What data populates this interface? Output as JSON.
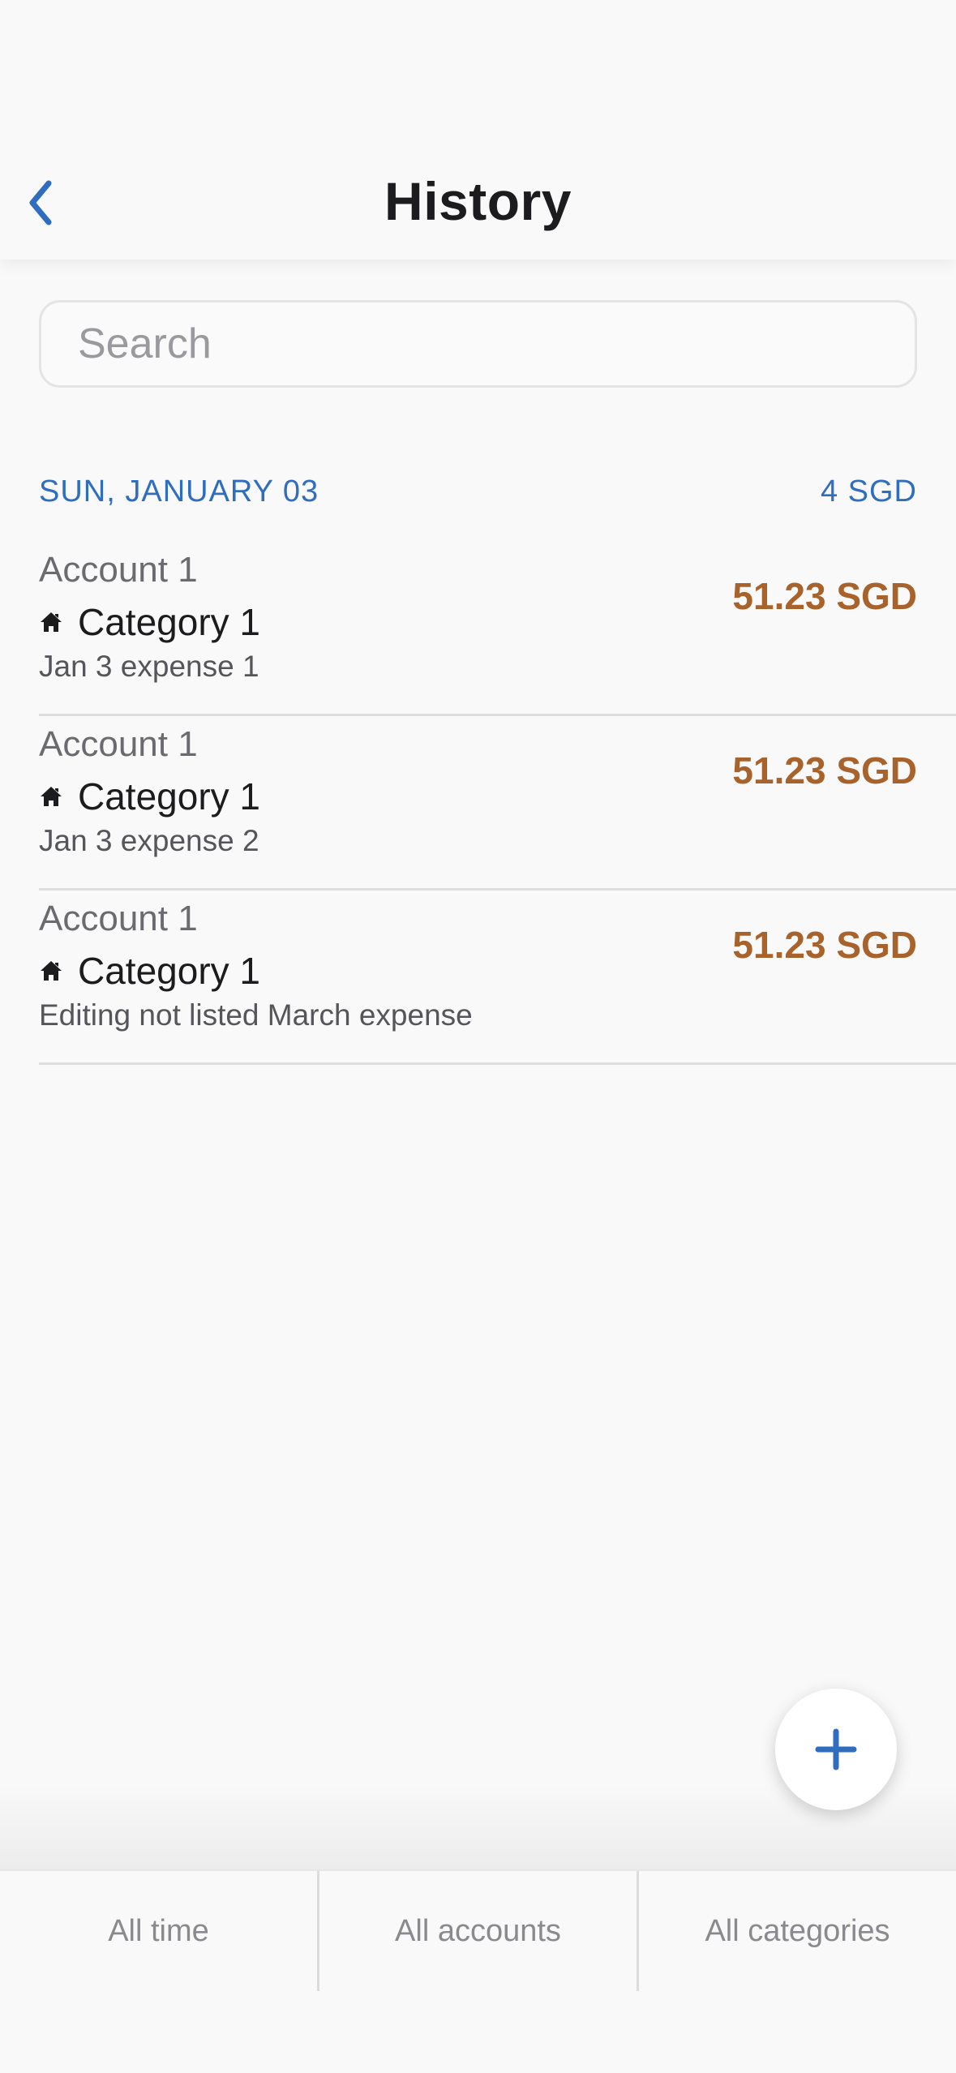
{
  "header": {
    "title": "History",
    "back_icon": "chevron-left-icon"
  },
  "search": {
    "placeholder": "Search",
    "value": ""
  },
  "section": {
    "date": "SUN, JANUARY 03",
    "total": "4 SGD"
  },
  "transactions": [
    {
      "account": "Account 1",
      "category": "Category 1",
      "category_icon": "home-icon",
      "note": "Jan 3 expense 1",
      "amount": "51.23 SGD"
    },
    {
      "account": "Account 1",
      "category": "Category 1",
      "category_icon": "home-icon",
      "note": "Jan 3 expense 2",
      "amount": "51.23 SGD"
    },
    {
      "account": "Account 1",
      "category": "Category 1",
      "category_icon": "home-icon",
      "note": "Editing not listed March expense",
      "amount": "51.23 SGD"
    }
  ],
  "fab": {
    "icon": "plus-icon"
  },
  "filters": {
    "time": "All time",
    "accounts": "All accounts",
    "categories": "All categories"
  },
  "colors": {
    "accent": "#2f6dbf",
    "expense": "#a8622c",
    "title": "#1c1c1e"
  }
}
